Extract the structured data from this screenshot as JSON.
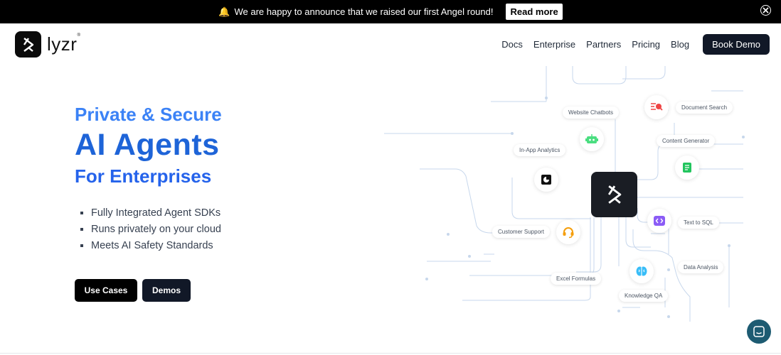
{
  "announcement": {
    "text": "We are happy to announce that we raised our first Angel round!",
    "emoji": "🔔",
    "cta_label": "Read more"
  },
  "header": {
    "logo_text": "lyzr",
    "nav": [
      "Docs",
      "Enterprise",
      "Partners",
      "Pricing",
      "Blog"
    ],
    "cta_label": "Book Demo"
  },
  "hero": {
    "line1": "Private & Secure",
    "line2": "AI Agents",
    "line3": "For Enterprises",
    "bullets": [
      "Fully Integrated Agent SDKs",
      "Runs privately on your cloud",
      "Meets AI Safety Standards"
    ],
    "buttons": {
      "use_cases": "Use Cases",
      "demos": "Demos"
    }
  },
  "diagram": {
    "labels": {
      "website_chatbots": "Website Chatbots",
      "document_search": "Document Search",
      "in_app_analytics": "In-App Analytics",
      "content_generator": "Content Generator",
      "customer_support": "Customer Support",
      "text_to_sql": "Text to SQL",
      "excel_formulas": "Excel Formulas",
      "data_analysis": "Data Analysis",
      "knowledge_qa": "Knowledge QA"
    },
    "colors": {
      "line": "#c7d7ec",
      "document_search": "#ef4444",
      "chatbot": "#4ade80",
      "content": "#22c55e",
      "support": "#f59e0b",
      "sql": "#8b5cf6",
      "knowledge": "#38bdf8"
    }
  }
}
